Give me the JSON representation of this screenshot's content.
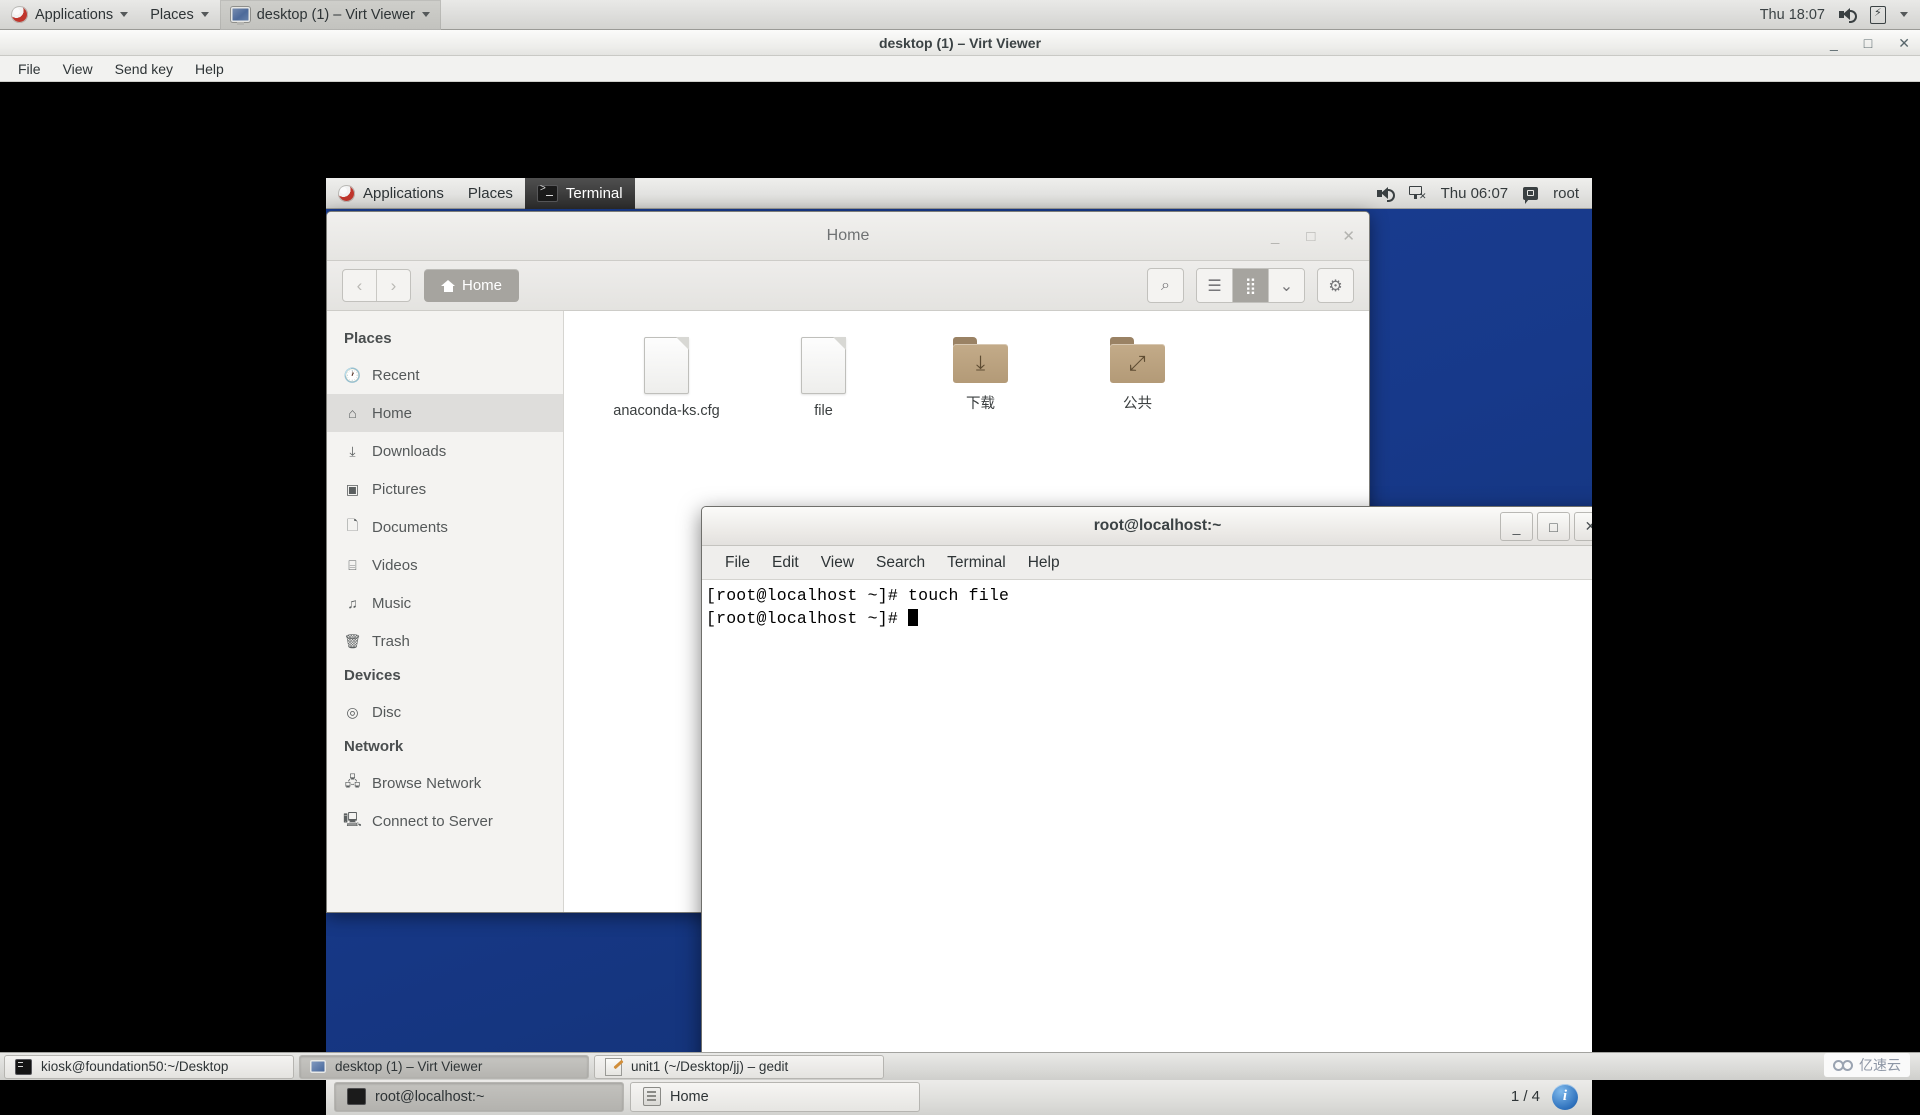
{
  "host": {
    "panel": {
      "applications": "Applications",
      "places": "Places",
      "window_item": "desktop (1) – Virt Viewer",
      "clock": "Thu 18:07",
      "icons": [
        "volume-icon",
        "battery-icon",
        "chevron-down-icon"
      ]
    },
    "taskbar": {
      "items": [
        {
          "label": "kiosk@foundation50:~/Desktop",
          "icon": "terminal-icon",
          "active": false
        },
        {
          "label": "desktop (1) – Virt Viewer",
          "icon": "display-icon",
          "active": true
        },
        {
          "label": "unit1 (~/Desktop/jj) – gedit",
          "icon": "gedit-icon",
          "active": false
        }
      ]
    },
    "watermark": "亿速云"
  },
  "virt_viewer": {
    "title": "desktop (1) – Virt Viewer",
    "window_buttons": {
      "minimize": "_",
      "maximize": "□",
      "close": "✕"
    },
    "menu": [
      "File",
      "View",
      "Send key",
      "Help"
    ]
  },
  "guest": {
    "panel": {
      "applications": "Applications",
      "places": "Places",
      "active_window": "Terminal",
      "clock": "Thu 06:07",
      "user": "root",
      "icons": [
        "volume-icon",
        "network-disconnected-icon",
        "user-icon"
      ]
    },
    "files_window": {
      "title": "Home",
      "window_buttons": {
        "minimize": "_",
        "maximize": "□",
        "close": "✕"
      },
      "breadcrumb": "Home",
      "nav": {
        "back": "‹",
        "forward": "›"
      },
      "toolbar_icons": {
        "search": "search-icon",
        "list_view": "list-view-icon",
        "grid_view": "grid-view-icon",
        "view_options": "chevron-down-icon",
        "settings": "gear-icon"
      },
      "sidebar": {
        "places_header": "Places",
        "places_items": [
          {
            "label": "Recent",
            "icon": "clock-icon",
            "selected": false
          },
          {
            "label": "Home",
            "icon": "home-icon",
            "selected": true
          },
          {
            "label": "Downloads",
            "icon": "download-icon",
            "selected": false
          },
          {
            "label": "Pictures",
            "icon": "camera-icon",
            "selected": false
          },
          {
            "label": "Documents",
            "icon": "document-icon",
            "selected": false
          },
          {
            "label": "Videos",
            "icon": "film-icon",
            "selected": false
          },
          {
            "label": "Music",
            "icon": "music-icon",
            "selected": false
          },
          {
            "label": "Trash",
            "icon": "trash-icon",
            "selected": false
          }
        ],
        "devices_header": "Devices",
        "devices_items": [
          {
            "label": "Disc",
            "icon": "disc-icon",
            "selected": false
          }
        ],
        "network_header": "Network",
        "network_items": [
          {
            "label": "Browse Network",
            "icon": "network-icon",
            "selected": false
          },
          {
            "label": "Connect to Server",
            "icon": "server-icon",
            "selected": false
          }
        ]
      },
      "files": [
        {
          "name": "anaconda-ks.cfg",
          "type": "document"
        },
        {
          "name": "file",
          "type": "document"
        },
        {
          "name": "下载",
          "type": "folder-download"
        },
        {
          "name": "公共",
          "type": "folder-public"
        }
      ]
    },
    "terminal_window": {
      "title": "root@localhost:~",
      "window_buttons": {
        "minimize": "_",
        "maximize": "□",
        "close": "✕"
      },
      "menu": [
        "File",
        "Edit",
        "View",
        "Search",
        "Terminal",
        "Help"
      ],
      "lines": [
        "[root@localhost ~]# touch file",
        "[root@localhost ~]# "
      ]
    },
    "taskbar": {
      "items": [
        {
          "label": "root@localhost:~",
          "icon": "terminal-icon",
          "active": true
        },
        {
          "label": "Home",
          "icon": "files-icon",
          "active": false
        }
      ],
      "workspace": "1 / 4",
      "info_button": "i"
    }
  }
}
